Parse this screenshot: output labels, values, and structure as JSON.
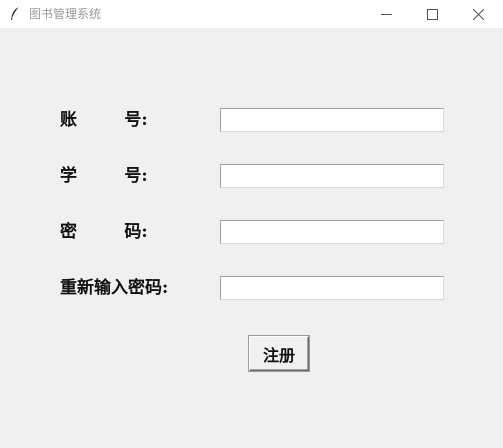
{
  "window": {
    "title": "图书管理系统",
    "controls": {
      "minimize": "minimize",
      "maximize": "maximize",
      "close": "close"
    }
  },
  "form": {
    "account_label": "账        号:",
    "student_id_label": "学        号:",
    "password_label": "密        码:",
    "confirm_password_label": "重新输入密码:",
    "account_value": "",
    "student_id_value": "",
    "password_value": "",
    "confirm_password_value": "",
    "register_button": "注册"
  },
  "colors": {
    "background": "#f0f0f0",
    "titlebar": "#ffffff",
    "title_text": "#9a9a9a"
  }
}
